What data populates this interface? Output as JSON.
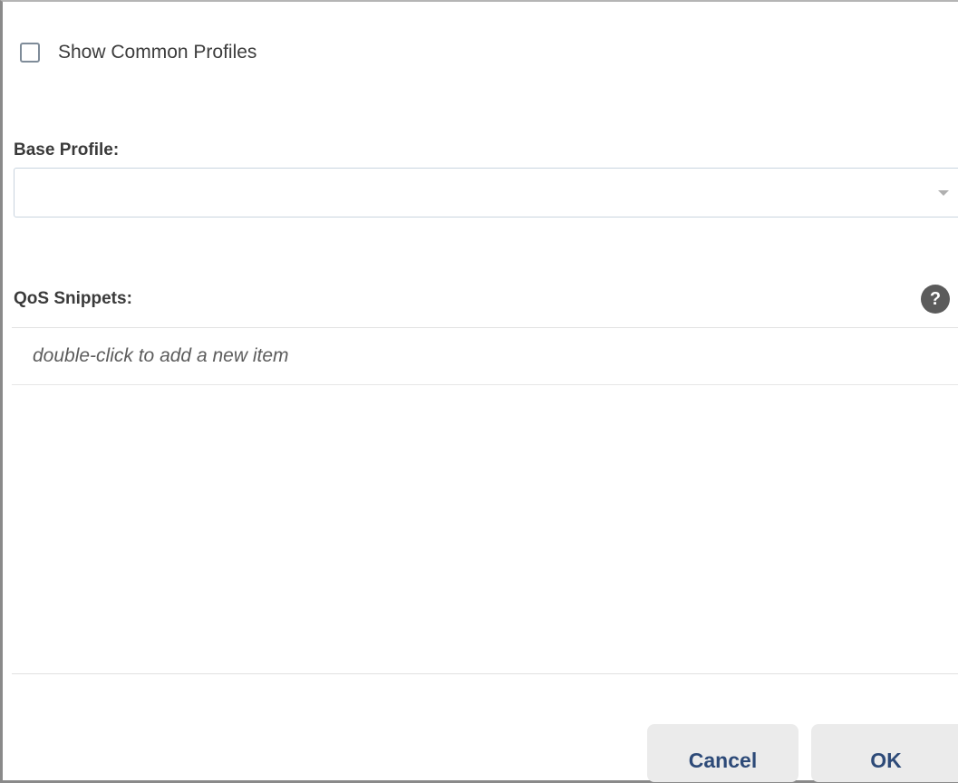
{
  "options": {
    "show_common_profiles_label": "Show Common Profiles",
    "show_common_profiles_checked": false
  },
  "base_profile": {
    "label": "Base Profile:",
    "value": ""
  },
  "qos_snippets": {
    "label": "QoS Snippets:",
    "help_icon": "question-circle-icon",
    "placeholder_row": "double-click to add a new item"
  },
  "footer": {
    "cancel_label": "Cancel",
    "ok_label": "OK"
  },
  "colors": {
    "button_text": "#2d4a78",
    "button_bg": "#ebebeb",
    "help_icon_bg": "#5b5b5b"
  }
}
